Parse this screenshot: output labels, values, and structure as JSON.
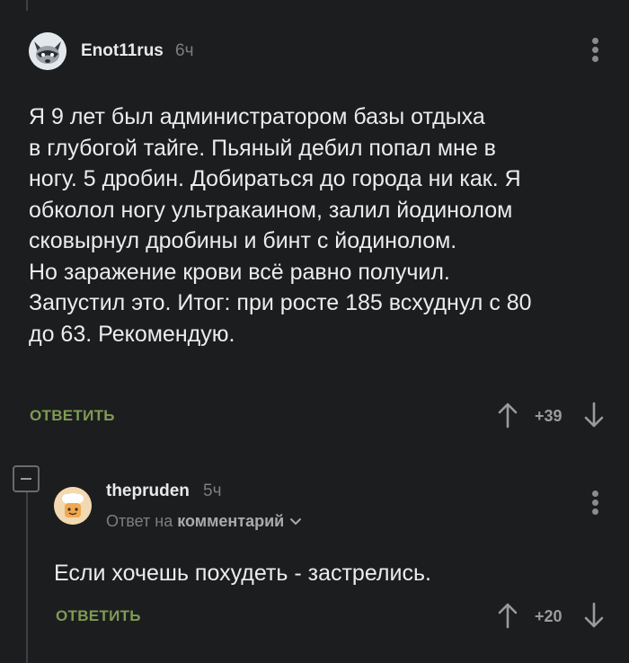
{
  "comments": [
    {
      "username": "Enot11rus",
      "time": "6ч",
      "text": "Я 9 лет был администратором базы отдыха\nв глубогой тайге. Пьяный дебил попал мне в\nногу. 5 дробин. Добираться до города ни как. Я\nобколол ногу ультракаином, залил йодинолом\nсковырнул дробины и бинт с йодинолом.\nНо заражение крови всё равно получил.\nЗапустил это. Итог: при росте 185 всхуднул с 80\nдо 63. Рекомендую.",
      "reply_label": "ОТВЕТИТЬ",
      "score": "+39"
    },
    {
      "username": "thepruden",
      "time": "5ч",
      "reply_prefix": "Ответ на",
      "reply_target": "комментарий",
      "text": "Если хочешь похудеть - застрелись.",
      "reply_label": "ОТВЕТИТЬ",
      "score": "+20"
    }
  ],
  "icons": {
    "upvote": "arrow-up-icon",
    "downvote": "arrow-down-icon",
    "menu": "more-vertical-icon",
    "collapse": "minus-icon"
  },
  "colors": {
    "background": "#1c1d1f",
    "reply_accent": "#7e9b54",
    "muted": "#7d7e80"
  }
}
